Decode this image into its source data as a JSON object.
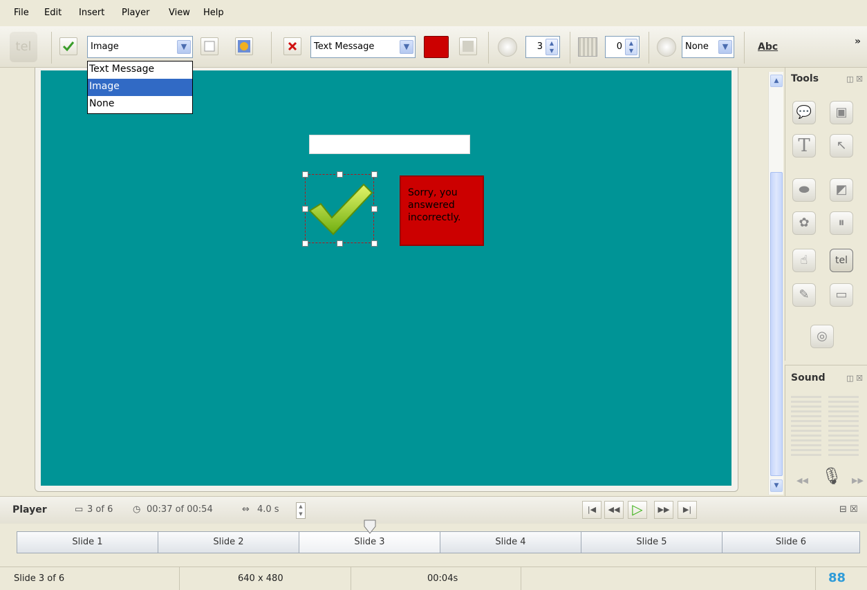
{
  "menu": [
    "File",
    "Edit",
    "Insert",
    "Player",
    "View",
    "Help"
  ],
  "toolbar": {
    "success_type": "Image",
    "failure_type": "Text Message",
    "attempts": "3",
    "timeout_count": "0",
    "timer": "None",
    "abc_label": "Abc",
    "overflow": "»"
  },
  "dropdown": {
    "options": [
      "Text Message",
      "Image",
      "None"
    ],
    "selected": "Image"
  },
  "slide": {
    "feedback_text": "Sorry, you answered incorrectly."
  },
  "panels": {
    "tools_title": "Tools",
    "sound_title": "Sound"
  },
  "player": {
    "label": "Player",
    "slide_pos": "3 of 6",
    "time": "00:37 of 00:54",
    "duration": "4.0 s"
  },
  "slides": [
    "Slide 1",
    "Slide 2",
    "Slide 3",
    "Slide 4",
    "Slide 5",
    "Slide 6"
  ],
  "current_slide_index": 2,
  "status": {
    "slide": "Slide 3 of 6",
    "size": "640 x 480",
    "time": "00:04s"
  },
  "colors": {
    "slide_bg": "#009496",
    "feedback_bg": "#cc0000",
    "selection": "#316ac5"
  }
}
